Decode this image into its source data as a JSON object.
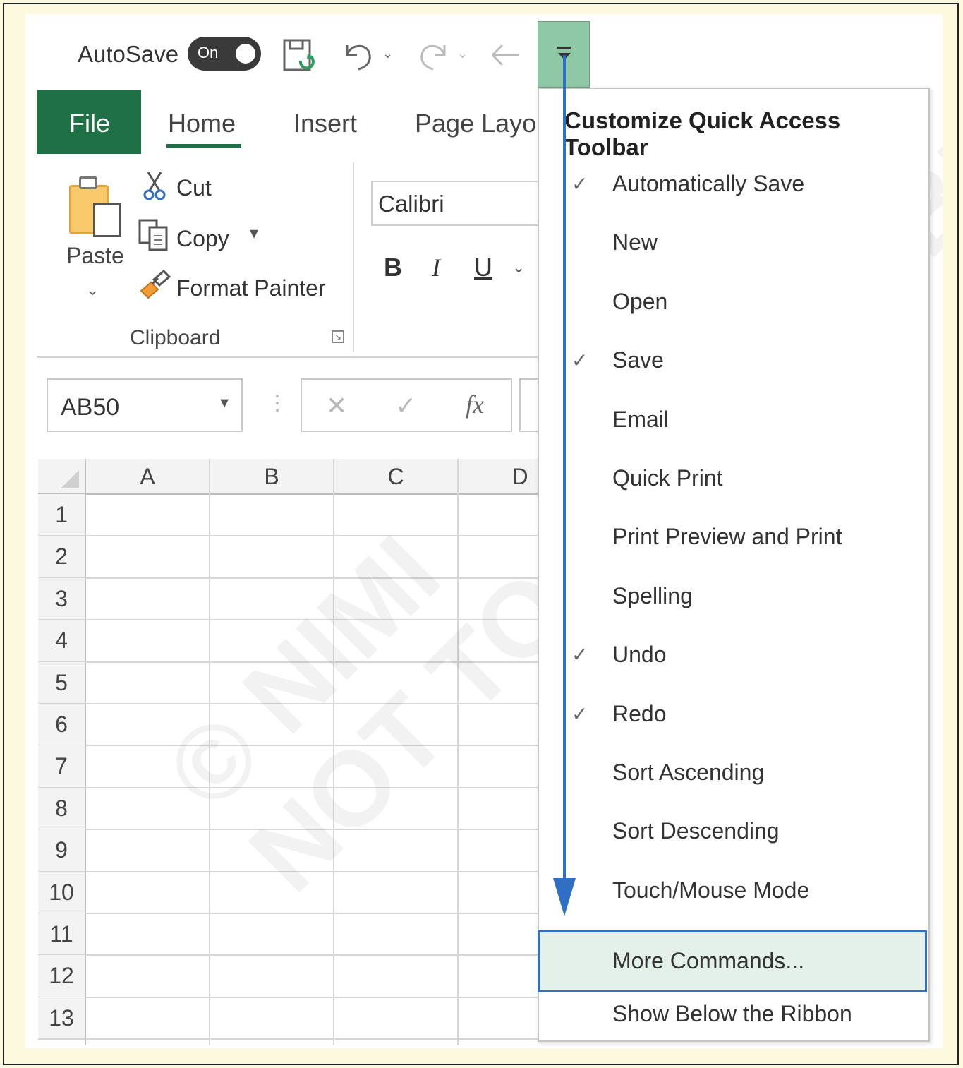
{
  "qat": {
    "autosave_label": "AutoSave",
    "autosave_state": "On",
    "icons": [
      "save-icon",
      "undo-icon",
      "redo-icon",
      "back-arrow-icon",
      "customize-toolbar-icon"
    ]
  },
  "ribbon": {
    "tabs": [
      "File",
      "Home",
      "Insert",
      "Page Layou"
    ],
    "active_tab": "Home",
    "clipboard": {
      "paste": "Paste",
      "cut": "Cut",
      "copy": "Copy",
      "format_painter": "Format Painter",
      "group_label": "Clipboard"
    },
    "font": {
      "name": "Calibri",
      "bold": "B",
      "italic": "I",
      "underline": "U"
    }
  },
  "formula_bar": {
    "name_box": "AB50",
    "cancel": "✕",
    "enter": "✓",
    "fx": "fx"
  },
  "grid": {
    "columns": [
      "A",
      "B",
      "C",
      "D"
    ],
    "rows": [
      "1",
      "2",
      "3",
      "4",
      "5",
      "6",
      "7",
      "8",
      "9",
      "10",
      "11",
      "12",
      "13"
    ]
  },
  "menu": {
    "title": "Customize Quick Access Toolbar",
    "items": [
      {
        "label": "Automatically Save",
        "checked": true
      },
      {
        "label": "New",
        "checked": false
      },
      {
        "label": "Open",
        "checked": false
      },
      {
        "label": "Save",
        "checked": true
      },
      {
        "label": "Email",
        "checked": false
      },
      {
        "label": "Quick Print",
        "checked": false
      },
      {
        "label": "Print Preview and Print",
        "checked": false
      },
      {
        "label": "Spelling",
        "checked": false
      },
      {
        "label": "Undo",
        "checked": true
      },
      {
        "label": "Redo",
        "checked": true
      },
      {
        "label": "Sort Ascending",
        "checked": false
      },
      {
        "label": "Sort Descending",
        "checked": false
      },
      {
        "label": "Touch/Mouse Mode",
        "checked": false
      },
      {
        "label": "More Commands...",
        "checked": false,
        "highlighted": true
      },
      {
        "label": "Show Below the Ribbon",
        "checked": false
      }
    ],
    "check_glyph": "✓"
  },
  "watermark": [
    "© NIMI",
    "NOT TO BE REPUBLISHED"
  ],
  "colors": {
    "excel_green": "#1e7145",
    "highlight_border": "#2f6fc4",
    "highlight_bg": "#e4f1ea",
    "customize_button": "#8fc8a4"
  }
}
